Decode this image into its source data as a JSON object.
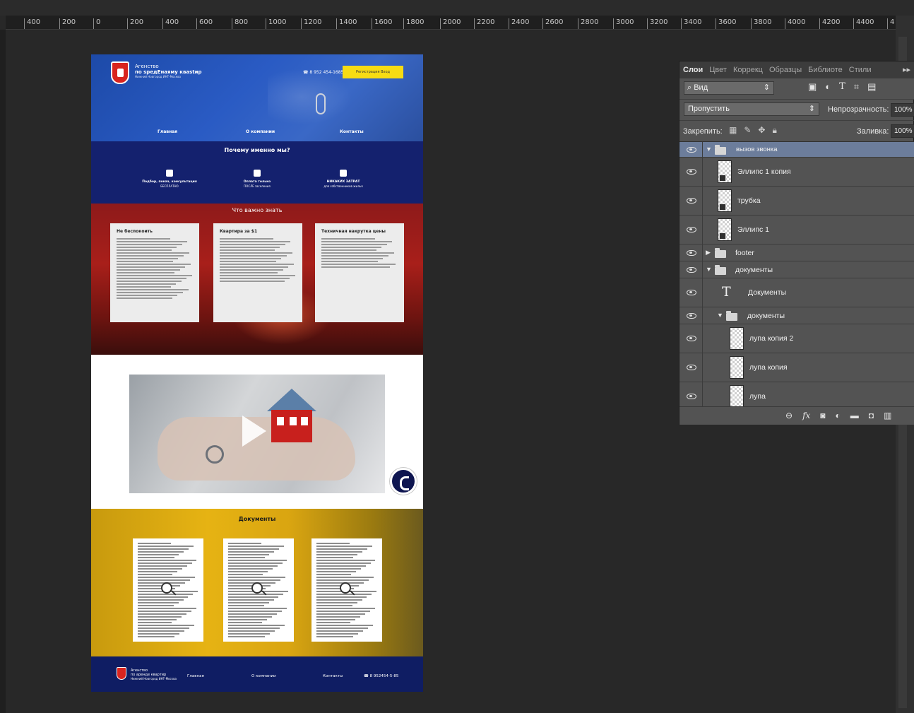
{
  "ruler": {
    "ticks": [
      "400",
      "200",
      "0",
      "200",
      "400",
      "600",
      "800",
      "1000",
      "1200",
      "1400",
      "1600",
      "1800",
      "2000",
      "2200",
      "2400",
      "2600",
      "2800",
      "3000",
      "3200",
      "3400",
      "3600",
      "3800",
      "4000",
      "4200",
      "4400",
      "4"
    ]
  },
  "document": {
    "header": {
      "logo_line1": "Агенство",
      "logo_line2": "по sредЕнаяму кваstир",
      "logo_line3": "Нижний Новгород ИНТ-Москва",
      "phone": "8 952 454-1685",
      "register_button": "Регистрация  Вход",
      "nav": [
        "Главная",
        "О компании",
        "Контакты"
      ]
    },
    "why": {
      "title": "Почему именно мы?",
      "items": [
        {
          "line1": "Подбор, показ, консультация",
          "line2": "БЕСПЛАТНО"
        },
        {
          "line1": "Оплата только",
          "line2": "ПОСЛЕ заселения"
        },
        {
          "line1": "НИКАКИХ ЗАТРАТ",
          "line2": "для собственников жилья"
        }
      ]
    },
    "important": {
      "title": "Что важно знать",
      "cards": [
        {
          "title": "Не беспокоить"
        },
        {
          "title": "Квартира за $1"
        },
        {
          "title": "Техничная накрутка цены"
        }
      ]
    },
    "documents": {
      "title": "Документы"
    },
    "footer": {
      "logo_line1": "Агенство",
      "logo_line2": "по аренде квартир",
      "logo_line3": "Нижний Новгород ИНТ-Москва",
      "nav": [
        "Главная",
        "О компании",
        "Контакты"
      ],
      "phone": "8 952454-5-85"
    }
  },
  "panel": {
    "tabs": [
      "Слои",
      "Цвет",
      "Коррекц",
      "Образцы",
      "Библиоте",
      "Стили"
    ],
    "active_tab": "Слои",
    "kind_filter": "Вид",
    "blend_mode": "Пропустить",
    "opacity_label": "Непрозрачность:",
    "opacity_value": "100%",
    "lock_label": "Закрепить:",
    "fill_label": "Заливка:",
    "fill_value": "100%",
    "layers": [
      {
        "name": "вызов звонка",
        "kind": "group",
        "expanded": true,
        "selected": true
      },
      {
        "name": "Эллипс 1 копия",
        "kind": "shape"
      },
      {
        "name": "трубка",
        "kind": "smart"
      },
      {
        "name": "Эллипс 1",
        "kind": "shape"
      },
      {
        "name": "footer",
        "kind": "group",
        "expanded": false
      },
      {
        "name": "документы",
        "kind": "group",
        "expanded": true
      },
      {
        "name": "Документы",
        "kind": "text"
      },
      {
        "name": "документы",
        "kind": "group",
        "expanded": true
      },
      {
        "name": "лупа копия 2",
        "kind": "pixel"
      },
      {
        "name": "лупа копия",
        "kind": "pixel"
      },
      {
        "name": "лупа",
        "kind": "pixel"
      }
    ]
  }
}
